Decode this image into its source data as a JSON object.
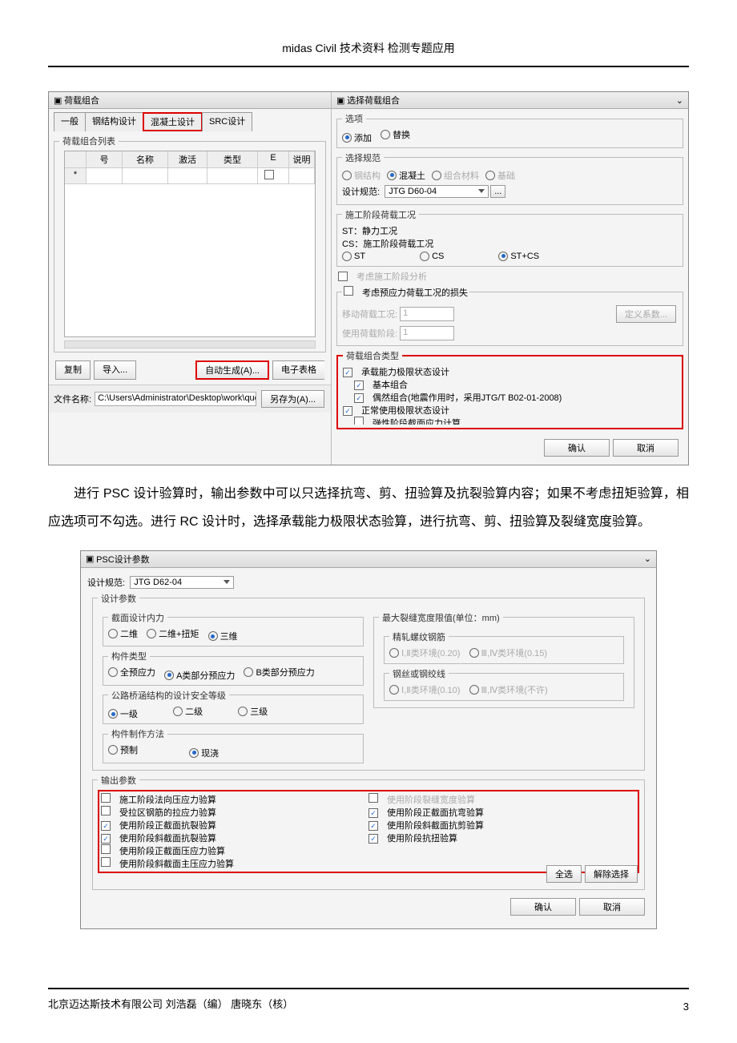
{
  "header": "midas Civil 技术资料  检测专题应用",
  "d1": {
    "title_l": "荷载组合",
    "title_r": "选择荷载组合",
    "tabs": [
      "一般",
      "钢结构设计",
      "混凝土设计",
      "SRC设计"
    ],
    "list_legend": "荷载组合列表",
    "cols": {
      "num": "号",
      "name": "名称",
      "act": "激活",
      "type": "类型",
      "e": "E",
      "desc": "说明"
    },
    "btns": {
      "copy": "复制",
      "import": "导入...",
      "auto": "自动生成(A)...",
      "sheet": "电子表格"
    },
    "file_l": "文件名称:",
    "file_v": "C:\\Users\\Administrator\\Desktop\\work\\question",
    "save": "另存为(A)...",
    "opt_legend": "选项",
    "add": "添加",
    "replace": "替换",
    "spec_legend": "选择规范",
    "steel": "钢结构",
    "conc": "混凝土",
    "comp": "组合材料",
    "found": "基础",
    "spec_l": "设计规范:",
    "spec_v": "JTG D60-04",
    "cs_legend": "施工阶段荷载工况",
    "st": "ST：静力工况",
    "cs": "CS：施工阶段荷载工况",
    "r_st": "ST",
    "r_cs": "CS",
    "r_stcs": "ST+CS",
    "anal": "考虑施工阶段分析",
    "loss": "考虑预应力荷载工况的损失",
    "move_l": "移动荷载工况:",
    "use_l": "使用荷载阶段:",
    "coef": "定义系数...",
    "type_legend": "荷载组合类型",
    "c1": "承载能力极限状态设计",
    "c2": "基本组合",
    "c3": "偶然组合(地震作用时，采用JTG/T B02-01-2008)",
    "c4": "正常使用极限状态设计",
    "c5": "弹性阶段截面应力计算",
    "ok": "确认",
    "cancel": "取消"
  },
  "para": "进行 PSC 设计验算时，输出参数中可以只选择抗弯、剪、扭验算及抗裂验算内容；如果不考虑扭矩验算，相应选项可不勾选。进行 RC 设计时，选择承载能力极限状态验算，进行抗弯、剪、扭验算及裂缝宽度验算。",
  "d2": {
    "title": "PSC设计参数",
    "spec_l": "设计规范:",
    "spec_v": "JTG D62-04",
    "design_legend": "设计参数",
    "int_legend": "截面设计内力",
    "d2v": "二维",
    "d2t": "二维+扭矩",
    "d3": "三维",
    "member_legend": "构件类型",
    "m1": "全预应力",
    "m2": "A类部分预应力",
    "m3": "B类部分预应力",
    "safety_legend": "公路桥涵结构的设计安全等级",
    "g1": "一级",
    "g2": "二级",
    "g3": "三级",
    "make_legend": "构件制作方法",
    "p1": "预制",
    "p2": "现浇",
    "crack_legend": "最大裂缝宽度限值(单位：mm)",
    "rebar": "精轧螺纹钢筋",
    "r12": "Ⅰ,Ⅱ类环境(0.20)",
    "r34": "Ⅲ,Ⅳ类环境(0.15)",
    "wire": "钢丝或钢绞线",
    "w12": "Ⅰ,Ⅱ类环境(0.10)",
    "w34": "Ⅲ,Ⅳ类环境(不许)",
    "out_legend": "输出参数",
    "o1": "施工阶段法向压应力验算",
    "o2": "受拉区钢筋的拉应力验算",
    "o3": "使用阶段正截面抗裂验算",
    "o4": "使用阶段斜截面抗裂验算",
    "o5": "使用阶段正截面压应力验算",
    "o6": "使用阶段斜截面主压应力验算",
    "o7": "使用阶段裂缝宽度验算",
    "o8": "使用阶段正截面抗弯验算",
    "o9": "使用阶段斜截面抗剪验算",
    "o10": "使用阶段抗扭验算",
    "all": "全选",
    "clear": "解除选择",
    "ok": "确认",
    "cancel": "取消"
  },
  "footer": {
    "l": "北京迈达斯技术有限公司 刘浩磊（编）  唐晓东（核）",
    "p": "3"
  }
}
